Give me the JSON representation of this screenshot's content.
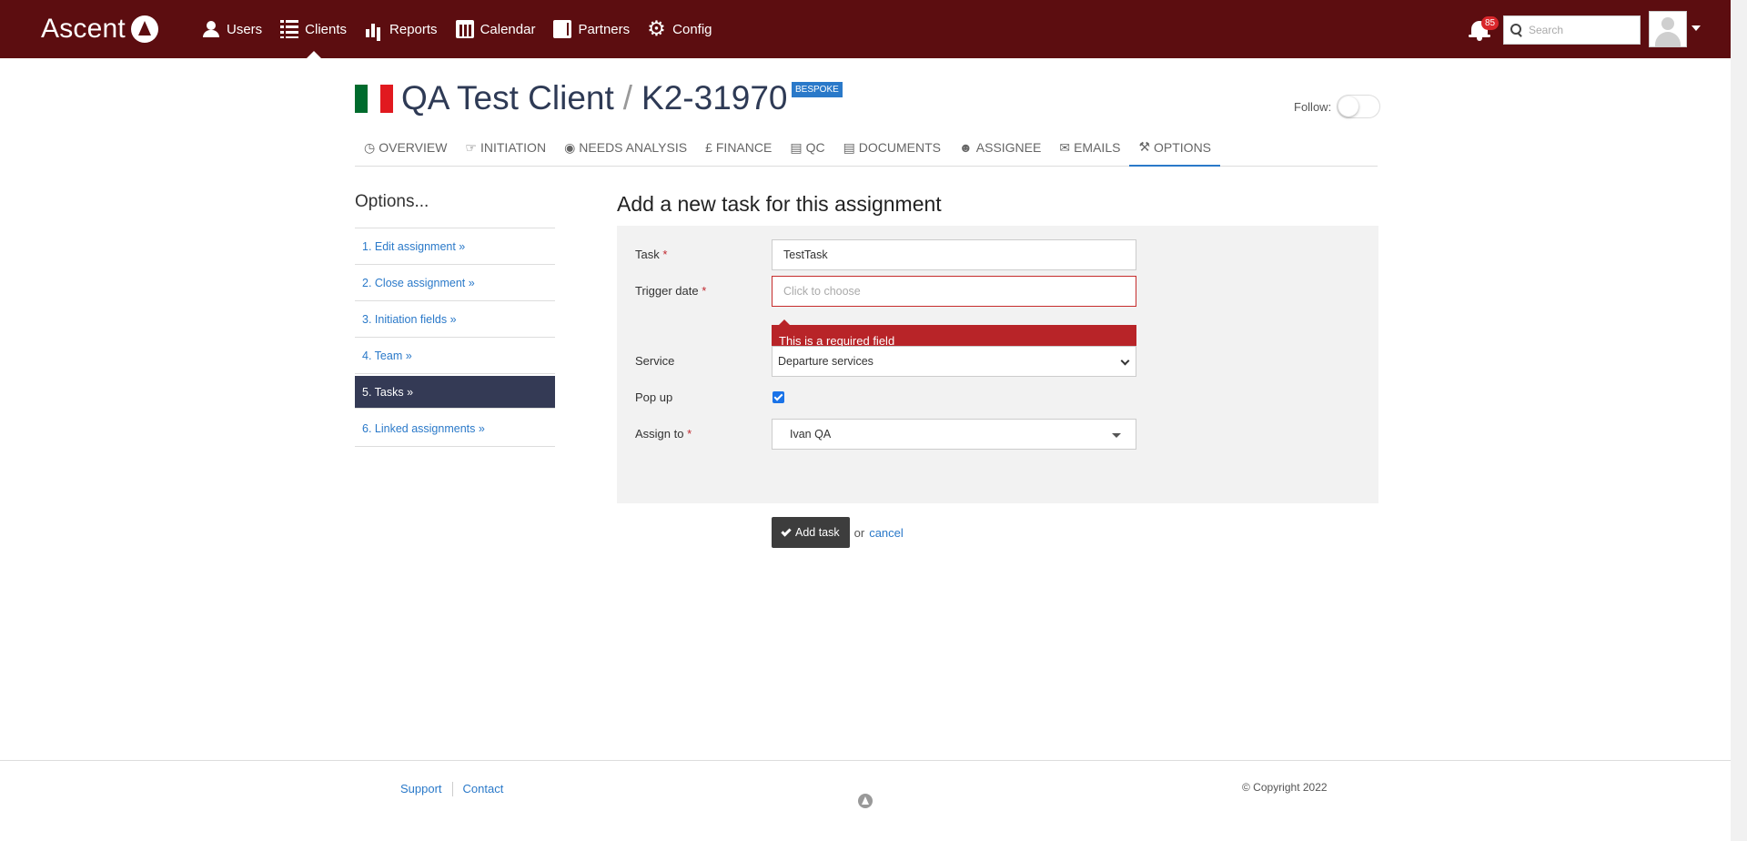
{
  "brand": {
    "name": "Ascent"
  },
  "nav": {
    "items": [
      {
        "label": "Users",
        "icon": "user-icon"
      },
      {
        "label": "Clients",
        "icon": "list-icon",
        "active": true
      },
      {
        "label": "Reports",
        "icon": "bar-chart-icon"
      },
      {
        "label": "Calendar",
        "icon": "calendar-icon"
      },
      {
        "label": "Partners",
        "icon": "book-icon"
      },
      {
        "label": "Config",
        "icon": "gear-icon"
      }
    ],
    "notifications": {
      "icon": "bell-icon",
      "count": "85"
    },
    "search": {
      "placeholder": "Search",
      "icon": "search-icon"
    },
    "avatar": {
      "icon": "user-avatar-icon"
    }
  },
  "header": {
    "flag": {
      "name": "italy-flag-icon",
      "colors": [
        "#006b2d",
        "#ffffff",
        "#e1191f"
      ]
    },
    "client": "QA Test Client",
    "separator": "/",
    "assignment": "K2-31970",
    "badge": "BESPOKE",
    "follow_label": "Follow:",
    "follow_on": false
  },
  "tabs": [
    {
      "label": "OVERVIEW",
      "icon": "clock-icon",
      "glyph": "◷"
    },
    {
      "label": "INITIATION",
      "icon": "pointer-icon",
      "glyph": "☞"
    },
    {
      "label": "NEEDS ANALYSIS",
      "icon": "eye-icon",
      "glyph": "◉"
    },
    {
      "label": "FINANCE",
      "icon": "pound-icon",
      "glyph": "£"
    },
    {
      "label": "QC",
      "icon": "book-icon",
      "glyph": "▤"
    },
    {
      "label": "DOCUMENTS",
      "icon": "file-icon",
      "glyph": "▤"
    },
    {
      "label": "ASSIGNEE",
      "icon": "user-icon",
      "glyph": "☻"
    },
    {
      "label": "EMAILS",
      "icon": "envelope-icon",
      "glyph": "✉"
    },
    {
      "label": "OPTIONS",
      "icon": "wrench-icon",
      "glyph": "⚒",
      "active": true
    }
  ],
  "sidebar": {
    "title": "Options...",
    "items": [
      {
        "label": "1. Edit assignment »"
      },
      {
        "label": "2. Close assignment »"
      },
      {
        "label": "3. Initiation fields »"
      },
      {
        "label": "4. Team »"
      },
      {
        "label": "5. Tasks »",
        "active": true
      },
      {
        "label": "6. Linked assignments »"
      }
    ]
  },
  "form": {
    "title": "Add a new task for this assignment",
    "task": {
      "label": "Task",
      "required": "*",
      "value": "TestTask"
    },
    "trigger_date": {
      "label": "Trigger date",
      "required": "*",
      "placeholder": "Click to choose",
      "error": "This is a required field"
    },
    "service": {
      "label": "Service",
      "value": "Departure services"
    },
    "popup": {
      "label": "Pop up",
      "checked": true
    },
    "assign_to": {
      "label": "Assign to",
      "required": "*",
      "value": "Ivan QA"
    },
    "submit_label": "Add task",
    "or_text": "or",
    "cancel_label": "cancel"
  },
  "footer": {
    "links": [
      "Support",
      "Contact"
    ],
    "copyright": "© Copyright 2022"
  }
}
